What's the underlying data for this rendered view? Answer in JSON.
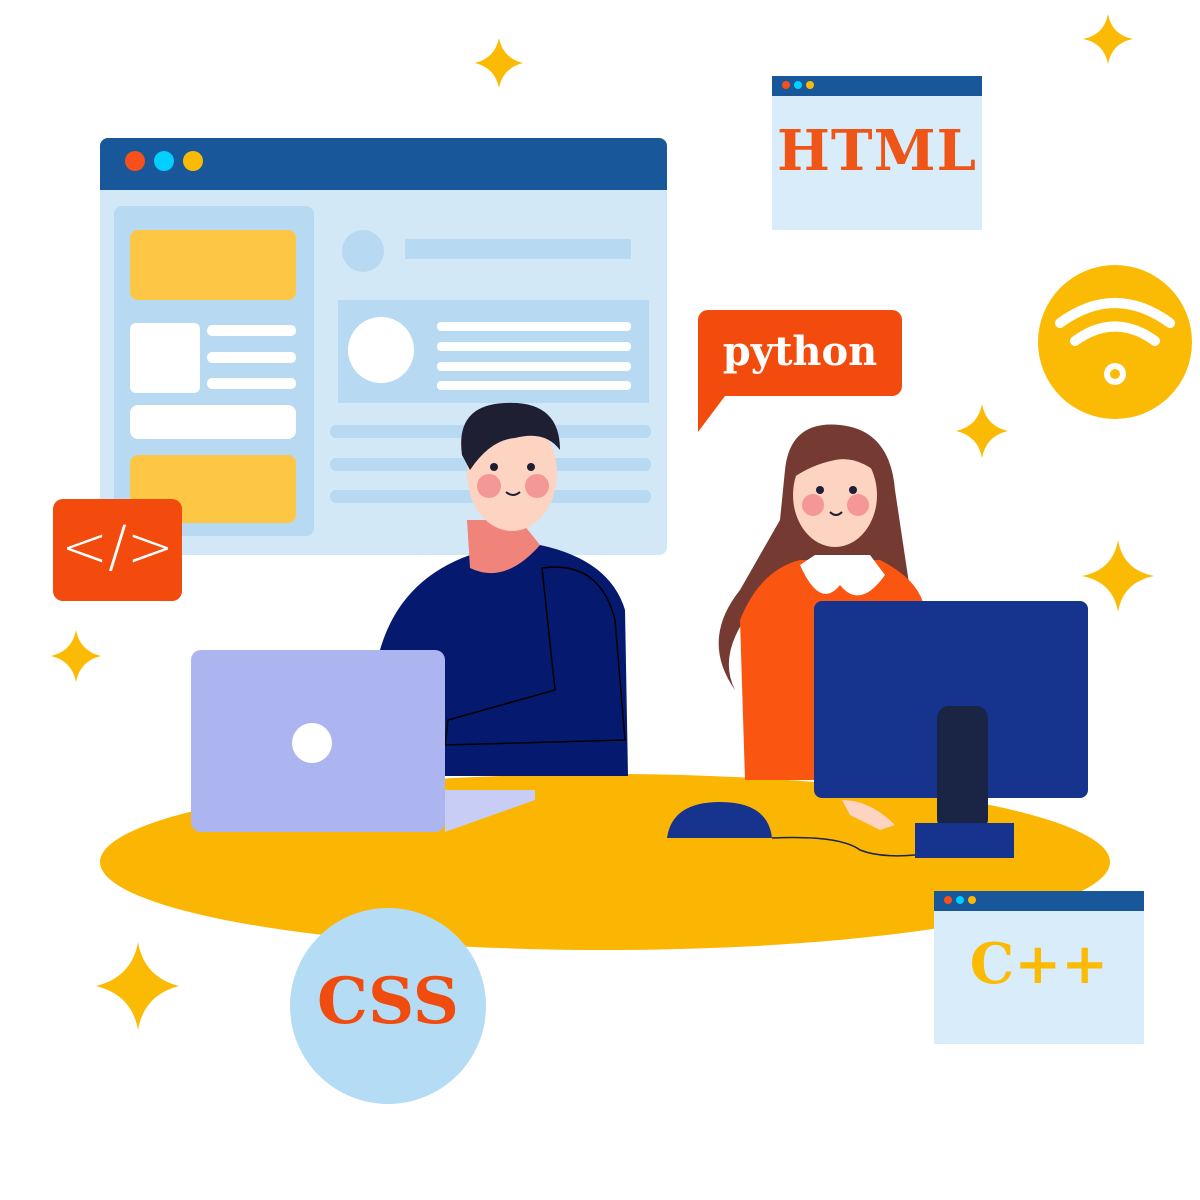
{
  "labels": {
    "html": "HTML",
    "python": "python",
    "css": "CSS",
    "cpp": "C++",
    "code": "</>"
  },
  "colors": {
    "navy": "#17579a",
    "window_bg": "#d3e8f7",
    "orange": "#f24b0d",
    "yellow": "#fbbb04",
    "light_blue": "#b5dcf5",
    "laptop": "#adb5f1",
    "monitor": "#16348e",
    "shirt_man": "#051a6e",
    "shirt_woman": "#fa5511"
  },
  "icons": {
    "wifi": "wifi-icon",
    "code": "code-icon",
    "sparkle": "sparkle-icon"
  }
}
